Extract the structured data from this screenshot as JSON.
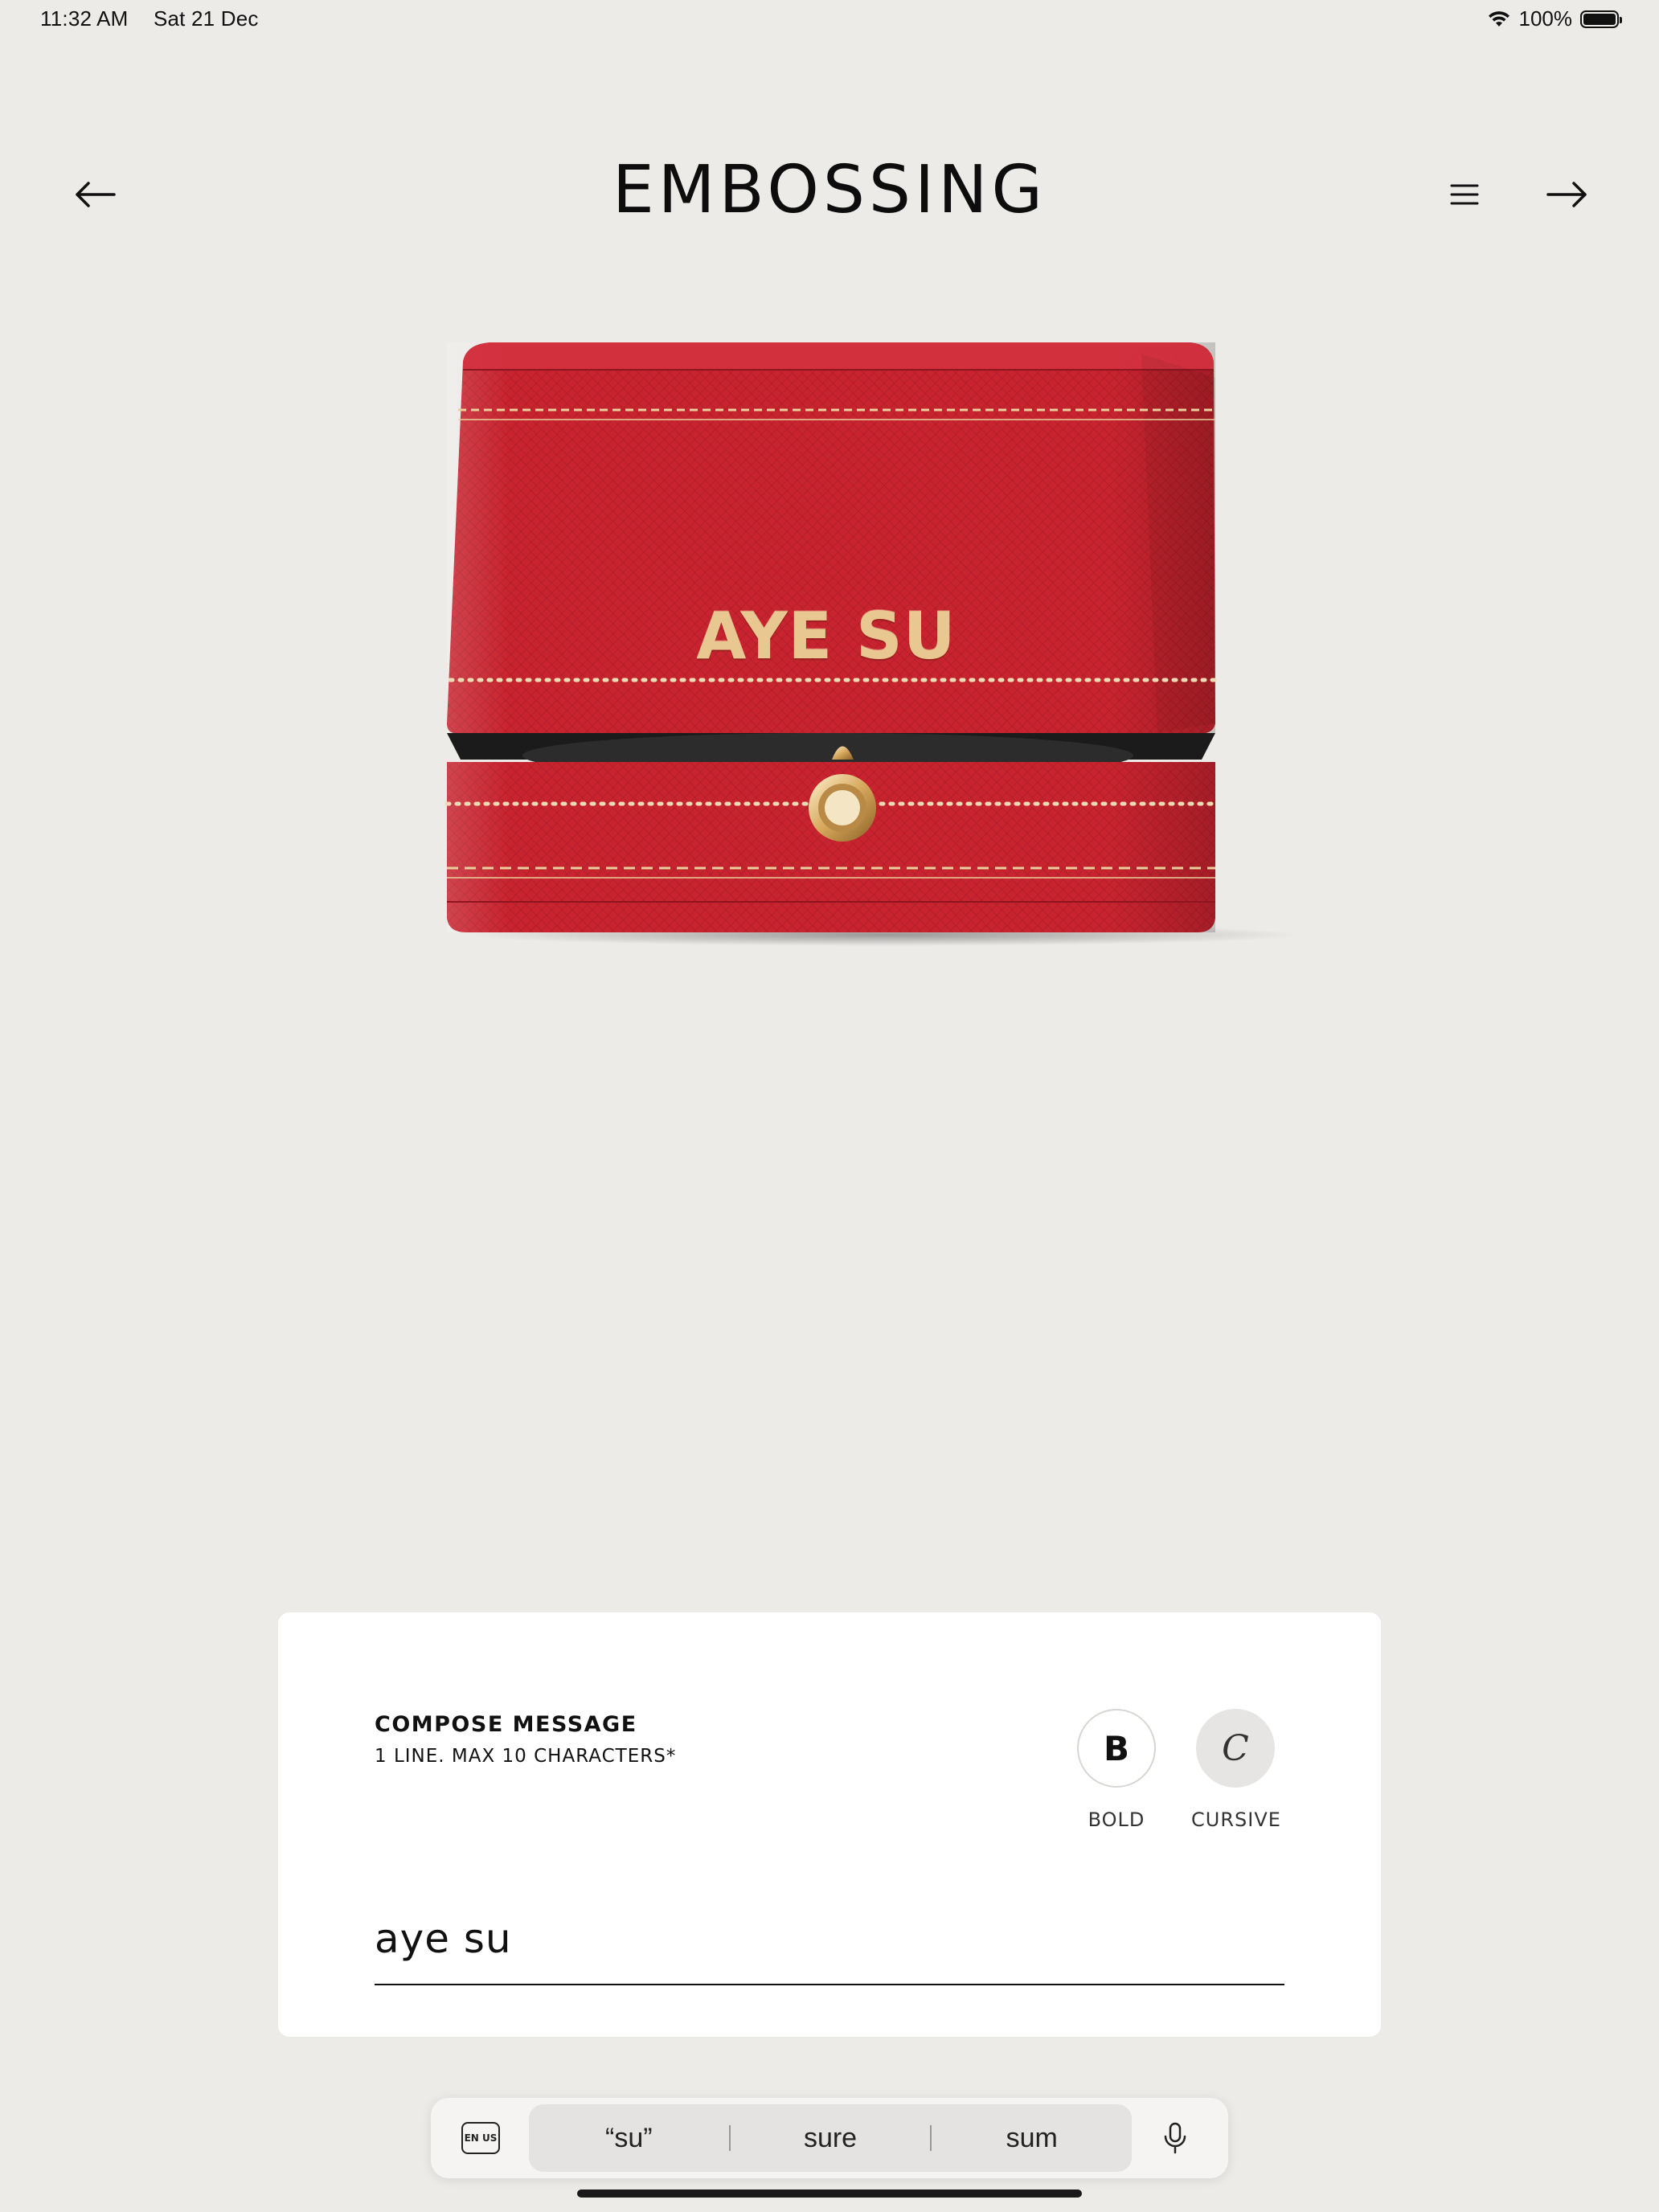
{
  "status_bar": {
    "time": "11:32 AM",
    "date": "Sat 21 Dec",
    "battery": "100%",
    "battery_level": 1.0
  },
  "header": {
    "title": "EMBOSSING",
    "back_icon": "arrow-left-icon",
    "menu_icon": "hamburger-menu-icon",
    "next_icon": "arrow-right-icon"
  },
  "product": {
    "engraving_text": "AYE SU",
    "box_color": "#c8242f",
    "accent_color": "#e8c890"
  },
  "compose": {
    "title": "COMPOSE MESSAGE",
    "subtitle": "1 LINE. MAX 10 CHARACTERS*",
    "styles": [
      {
        "label": "BOLD",
        "glyph": "B"
      },
      {
        "label": "CURSIVE",
        "glyph": "C"
      }
    ],
    "message_value": "aye su"
  },
  "keyboard": {
    "lang_label": "EN US",
    "suggestions": [
      "“su”",
      "sure",
      "sum"
    ],
    "mic_icon": "microphone-icon"
  }
}
